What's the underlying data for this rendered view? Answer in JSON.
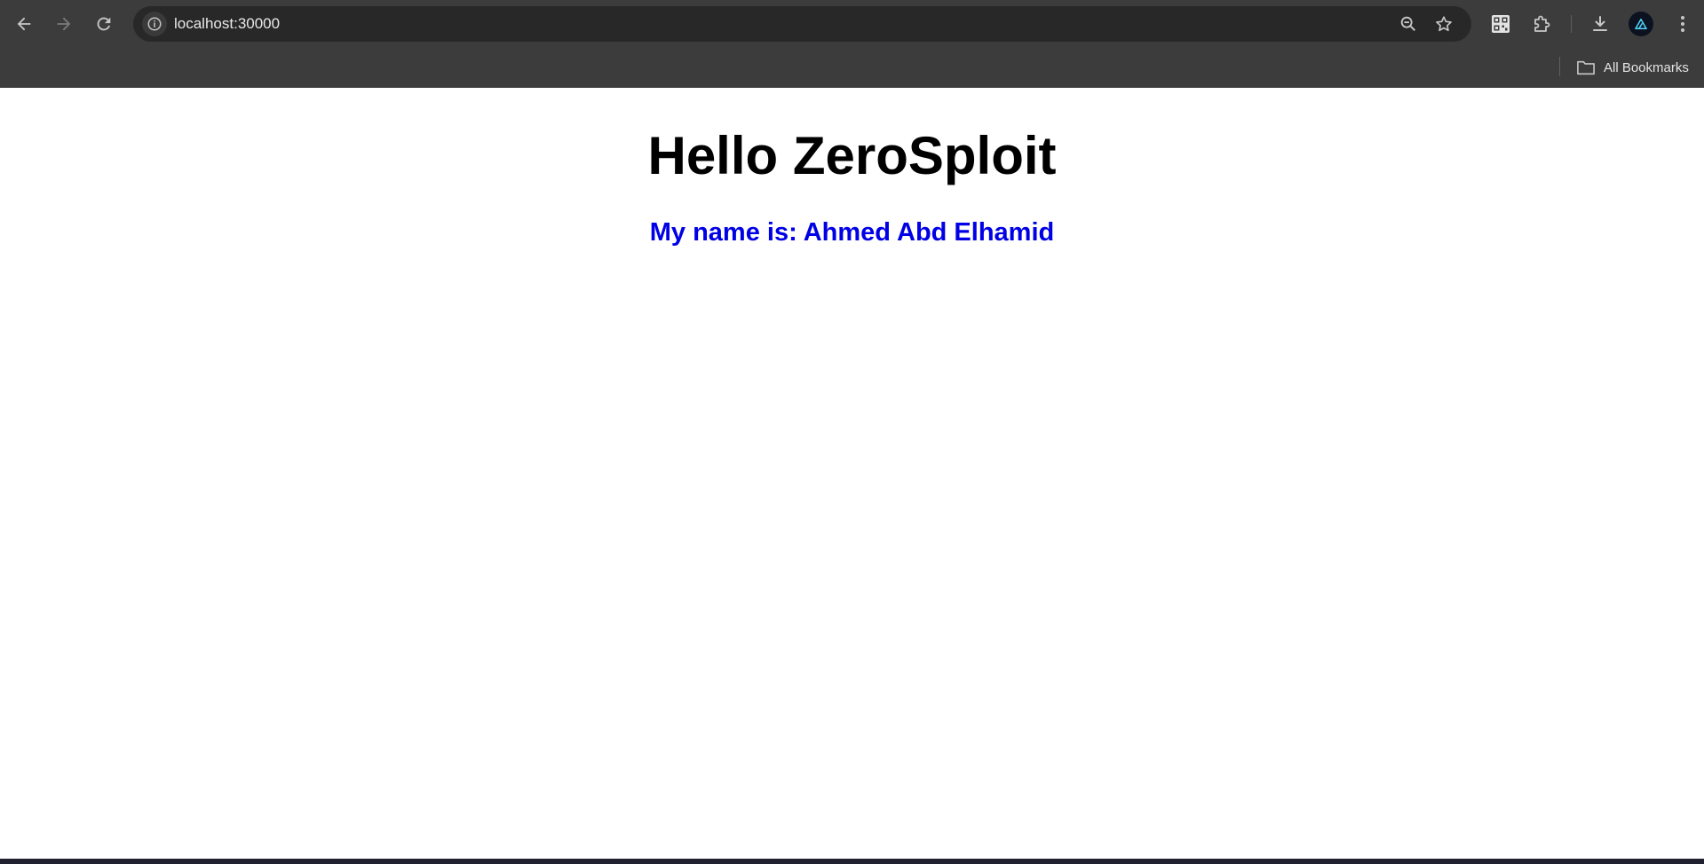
{
  "browser": {
    "url": "localhost:30000",
    "icons": {
      "back": "arrow-left-icon",
      "forward": "arrow-right-icon",
      "reload": "reload-icon",
      "site_info": "info-icon",
      "zoom": "zoom-out-icon",
      "bookmark": "star-icon",
      "qr": "qr-code-icon",
      "extensions": "puzzle-icon",
      "downloads": "download-icon",
      "menu": "kebab-menu-icon"
    }
  },
  "bookmarks_bar": {
    "all_bookmarks_label": "All Bookmarks"
  },
  "page": {
    "title": "Hello ZeroSploit",
    "name_line": "My name is: Ahmed Abd Elhamid",
    "name_color": "#0000e6"
  }
}
